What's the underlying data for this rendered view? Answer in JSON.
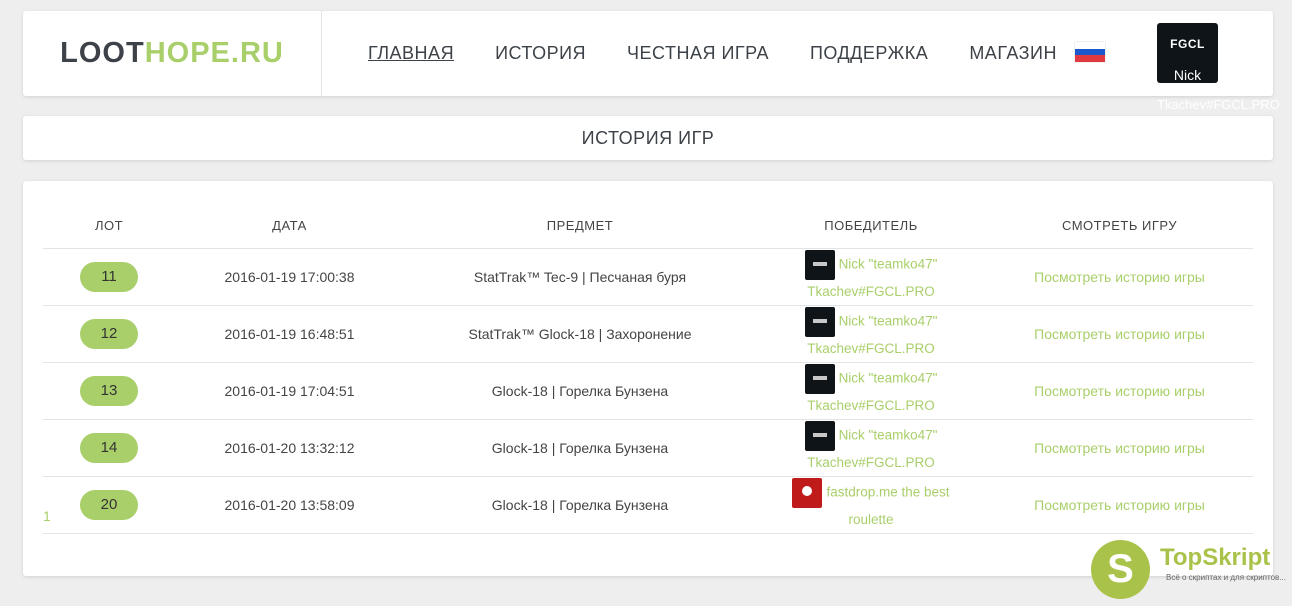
{
  "logo": {
    "part1": "LOOT",
    "part2": "HOPE.RU"
  },
  "nav": [
    "ГЛАВНАЯ",
    "ИСТОРИЯ",
    "ЧЕСТНАЯ ИГРА",
    "ПОДДЕРЖКА",
    "МАГАЗИН"
  ],
  "user": {
    "avatar_logo": "FGCL",
    "name": "Nick",
    "tag": "Tkachev#FGCL.PRO"
  },
  "colors": {
    "accent": "#a9cf6a",
    "flag": [
      "#ffffff",
      "#1c57cc",
      "#e2383f"
    ]
  },
  "title": "ИСТОРИЯ ИГР",
  "table": {
    "headers": [
      "ЛОТ",
      "ДАТА",
      "ПРЕДМЕТ",
      "ПОБЕДИТЕЛЬ",
      "СМОТРЕТЬ ИГРУ"
    ],
    "rows": [
      {
        "lot": "11",
        "date": "2016-01-19 17:00:38",
        "item": "StatTrak™ Tec-9 | Песчаная буря",
        "winner1": "Nick \"teamko47\"",
        "winner2": "Tkachev#FGCL.PRO",
        "view": "Посмотреть историю игры"
      },
      {
        "lot": "12",
        "date": "2016-01-19 16:48:51",
        "item": "StatTrak™ Glock-18 | Захоронение",
        "winner1": "Nick \"teamko47\"",
        "winner2": "Tkachev#FGCL.PRO",
        "view": "Посмотреть историю игры"
      },
      {
        "lot": "13",
        "date": "2016-01-19 17:04:51",
        "item": "Glock-18 | Горелка Бунзена",
        "winner1": "Nick \"teamko47\"",
        "winner2": "Tkachev#FGCL.PRO",
        "view": "Посмотреть историю игры"
      },
      {
        "lot": "14",
        "date": "2016-01-20 13:32:12",
        "item": "Glock-18 | Горелка Бунзена",
        "winner1": "Nick \"teamko47\"",
        "winner2": "Tkachev#FGCL.PRO",
        "view": "Посмотреть историю игры"
      },
      {
        "lot": "20",
        "date": "2016-01-20 13:58:09",
        "item": "Glock-18 | Горелка Бунзена",
        "winner1": "fastdrop.me the best",
        "winner2": "roulette",
        "view": "Посмотреть историю игры"
      }
    ]
  },
  "pagination": "1",
  "watermark": {
    "letter": "S",
    "title": "TopSkript",
    "subtitle": "Всё о скриптах и для скриптов..."
  }
}
